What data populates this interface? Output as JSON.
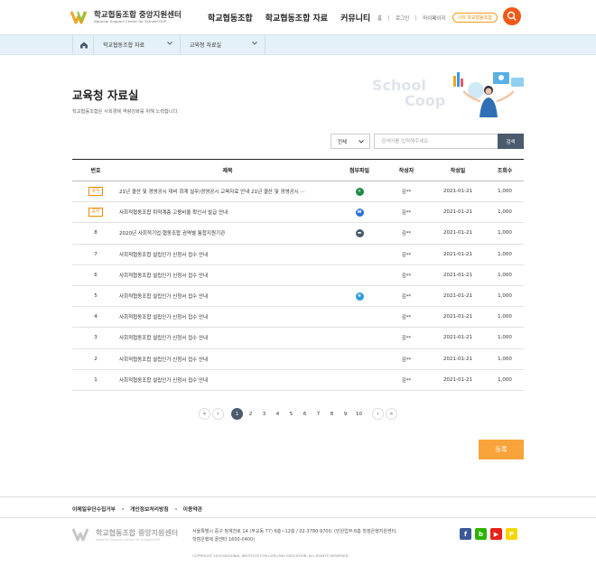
{
  "header": {
    "logo_title": "학교협동조합 중앙지원센터",
    "logo_subtitle": "National Support Center for SchoolCOOP",
    "gnb": [
      "학교협동조합",
      "학교협동조합 자료",
      "커뮤니티"
    ],
    "util": {
      "home": "홈",
      "login": "로그인",
      "mypage": "마이페이지",
      "my_coop": "나의 학교협동조합"
    },
    "accent": "#f05a16"
  },
  "breadcrumb": {
    "items": [
      "학교협동조합 자료",
      "교육청 자료실"
    ]
  },
  "page": {
    "title": "교육청 자료실",
    "description": "학교협동조합은 사회경제 역량강화를 위해 노력합니다.",
    "visual_text": [
      "School",
      "Coop"
    ]
  },
  "search": {
    "select_value": "전체",
    "placeholder": "검색어를 입력해주세요.",
    "button": "검색"
  },
  "table": {
    "headers": [
      "번호",
      "제목",
      "첨부파일",
      "작성자",
      "작성일",
      "조회수"
    ],
    "rows": [
      {
        "no": "공지",
        "notice": true,
        "title": "21년 결산 및 경영공시 대비 회계 실무/경영공시 교육자료 안내 21년 결산 및 경영공시 ···",
        "file": "excel",
        "writer": "김**",
        "date": "2021-01-21",
        "views": "1,000"
      },
      {
        "no": "공지",
        "notice": true,
        "title": "사회적협동조합 취약계층 고용비율 확인서 발급 안내",
        "file": "word",
        "writer": "김**",
        "date": "2021-01-21",
        "views": "1,000"
      },
      {
        "no": "8",
        "notice": false,
        "title": "2020년 사회적기업·협동조합 권역별 통합지원기관",
        "file": "folder",
        "writer": "김**",
        "date": "2021-01-21",
        "views": "1,000"
      },
      {
        "no": "7",
        "notice": false,
        "title": "사회적협동조합 설립인가 신청서 접수 안내",
        "file": "",
        "writer": "김**",
        "date": "2021-01-21",
        "views": "1,000"
      },
      {
        "no": "6",
        "notice": false,
        "title": "사회적협동조합 설립인가 신청서 접수 안내",
        "file": "",
        "writer": "김**",
        "date": "2021-01-21",
        "views": "1,000"
      },
      {
        "no": "5",
        "notice": false,
        "title": "사회적협동조합 설립인가 신청서 접수 안내",
        "file": "image",
        "writer": "김**",
        "date": "2021-01-21",
        "views": "1,000"
      },
      {
        "no": "4",
        "notice": false,
        "title": "사회적협동조합 설립인가 신청서 접수 안내",
        "file": "",
        "writer": "김**",
        "date": "2021-01-21",
        "views": "1,000"
      },
      {
        "no": "3",
        "notice": false,
        "title": "사회적협동조합 설립인가 신청서 접수 안내",
        "file": "",
        "writer": "김**",
        "date": "2021-01-21",
        "views": "1,000"
      },
      {
        "no": "2",
        "notice": false,
        "title": "사회적협동조합 설립인가 신청서 접수 안내",
        "file": "",
        "writer": "김**",
        "date": "2021-01-21",
        "views": "1,000"
      },
      {
        "no": "1",
        "notice": false,
        "title": "사회적협동조합 설립인가 신청서 접수 안내",
        "file": "",
        "writer": "김**",
        "date": "2021-01-21",
        "views": "1,000"
      }
    ]
  },
  "pagination": {
    "pages": [
      "1",
      "2",
      "3",
      "4",
      "5",
      "6",
      "7",
      "8",
      "9",
      "10"
    ],
    "current": "1"
  },
  "write_button": "등록",
  "footer": {
    "links": [
      "이메일무단수집거부",
      "개인정보처리방침",
      "이용약관"
    ],
    "logo_title": "학교협동조합 중앙지원센터",
    "logo_subtitle": "National Support Center for SchoolCOOP",
    "address": "서울특별시 중구 청계천로 14 (무교동 77) 6층~12층 / 02-3780-9700, (민원업무:6층 학점은행지원센터, 학점은행제 콜센터 1600-0400)",
    "copyright": "COPYRIGHT 2019 NATIONAL INSTITUTE FOR LIFELONG EDUCATION. ALL RIGHTS RESERVED.",
    "sns": [
      {
        "name": "facebook",
        "glyph": "f",
        "color": "#3b5998"
      },
      {
        "name": "blog",
        "glyph": "b",
        "color": "#2db400"
      },
      {
        "name": "youtube",
        "glyph": "▶",
        "color": "#e62117"
      },
      {
        "name": "kakao",
        "glyph": "P",
        "color": "#f7d600"
      }
    ]
  },
  "file_icon_colors": {
    "excel": "#1e8a46",
    "word": "#2b6fd6",
    "folder": "#4a5b6d",
    "image": "#2f9be0"
  }
}
